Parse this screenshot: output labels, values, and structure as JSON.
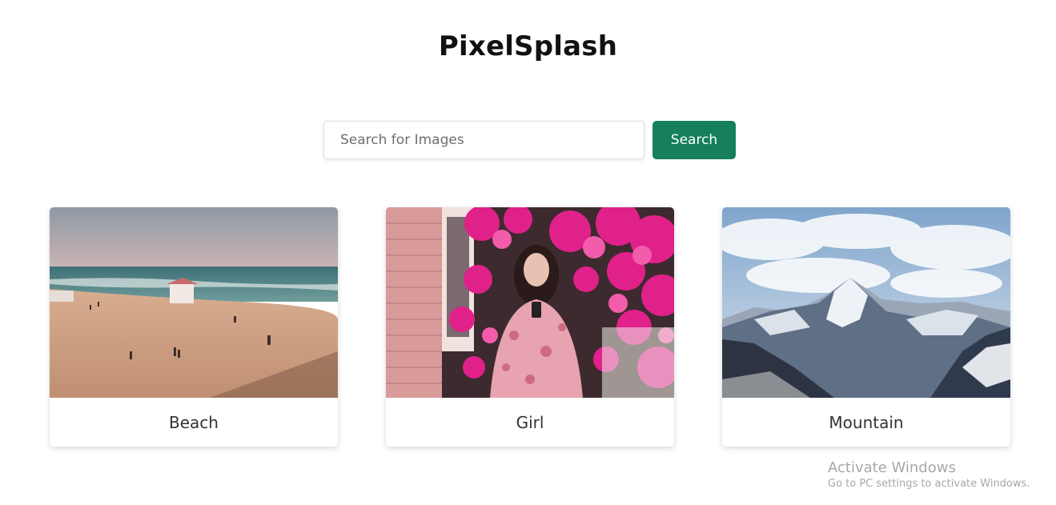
{
  "header": {
    "title": "PixelSplash"
  },
  "search": {
    "placeholder": "Search for Images",
    "value": "",
    "button_label": "Search"
  },
  "colors": {
    "accent": "#157f5e"
  },
  "results": [
    {
      "label": "Beach",
      "image": "beach-photo"
    },
    {
      "label": "Girl",
      "image": "girl-with-flowers-photo"
    },
    {
      "label": "Mountain",
      "image": "mountain-photo"
    }
  ],
  "watermark": {
    "title": "Activate Windows",
    "subtitle": "Go to PC settings to activate Windows."
  }
}
